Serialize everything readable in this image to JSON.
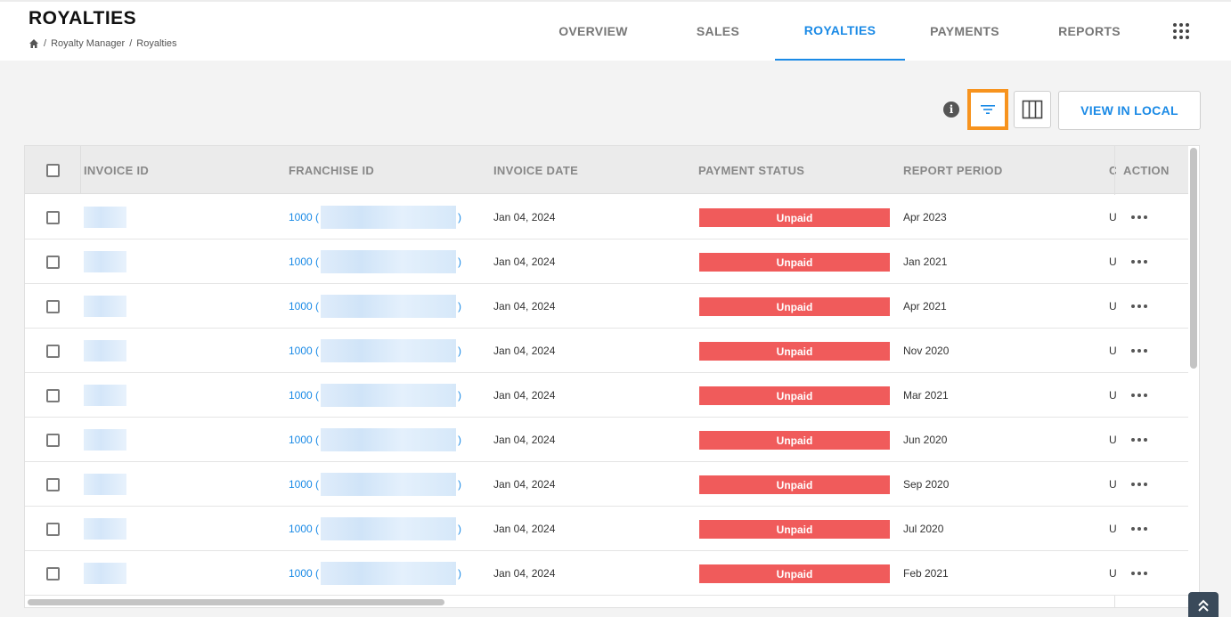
{
  "header": {
    "title": "ROYALTIES",
    "breadcrumb": [
      "/",
      "Royalty Manager",
      "/",
      "Royalties"
    ],
    "tabs": [
      {
        "label": "OVERVIEW",
        "active": false
      },
      {
        "label": "SALES",
        "active": false
      },
      {
        "label": "ROYALTIES",
        "active": true
      },
      {
        "label": "PAYMENTS",
        "active": false
      },
      {
        "label": "REPORTS",
        "active": false
      }
    ]
  },
  "toolbar": {
    "info_icon": "i",
    "view_local_label": "VIEW IN LOCAL"
  },
  "table": {
    "columns": [
      "INVOICE ID",
      "FRANCHISE ID",
      "INVOICE DATE",
      "PAYMENT STATUS",
      "REPORT PERIOD",
      "C",
      "ACTION"
    ],
    "rows": [
      {
        "franchise_prefix": "1000 (",
        "franchise_suffix": ")",
        "invoice_date": "Jan 04, 2024",
        "status": "Unpaid",
        "report_period": "Apr 2023",
        "truncated": "U"
      },
      {
        "franchise_prefix": "1000 (",
        "franchise_suffix": ")",
        "invoice_date": "Jan 04, 2024",
        "status": "Unpaid",
        "report_period": "Jan 2021",
        "truncated": "U"
      },
      {
        "franchise_prefix": "1000 (",
        "franchise_suffix": ")",
        "invoice_date": "Jan 04, 2024",
        "status": "Unpaid",
        "report_period": "Apr 2021",
        "truncated": "U"
      },
      {
        "franchise_prefix": "1000 (",
        "franchise_suffix": ")",
        "invoice_date": "Jan 04, 2024",
        "status": "Unpaid",
        "report_period": "Nov 2020",
        "truncated": "U"
      },
      {
        "franchise_prefix": "1000 (",
        "franchise_suffix": ")",
        "invoice_date": "Jan 04, 2024",
        "status": "Unpaid",
        "report_period": "Mar 2021",
        "truncated": "U"
      },
      {
        "franchise_prefix": "1000 (",
        "franchise_suffix": ")",
        "invoice_date": "Jan 04, 2024",
        "status": "Unpaid",
        "report_period": "Jun 2020",
        "truncated": "U"
      },
      {
        "franchise_prefix": "1000 (",
        "franchise_suffix": ")",
        "invoice_date": "Jan 04, 2024",
        "status": "Unpaid",
        "report_period": "Sep 2020",
        "truncated": "U"
      },
      {
        "franchise_prefix": "1000 (",
        "franchise_suffix": ")",
        "invoice_date": "Jan 04, 2024",
        "status": "Unpaid",
        "report_period": "Jul 2020",
        "truncated": "U"
      },
      {
        "franchise_prefix": "1000 (",
        "franchise_suffix": ")",
        "invoice_date": "Jan 04, 2024",
        "status": "Unpaid",
        "report_period": "Feb 2021",
        "truncated": "U"
      }
    ]
  },
  "colors": {
    "accent": "#1a8ae6",
    "unpaid": "#f05b5b",
    "highlight": "#f7931e"
  }
}
